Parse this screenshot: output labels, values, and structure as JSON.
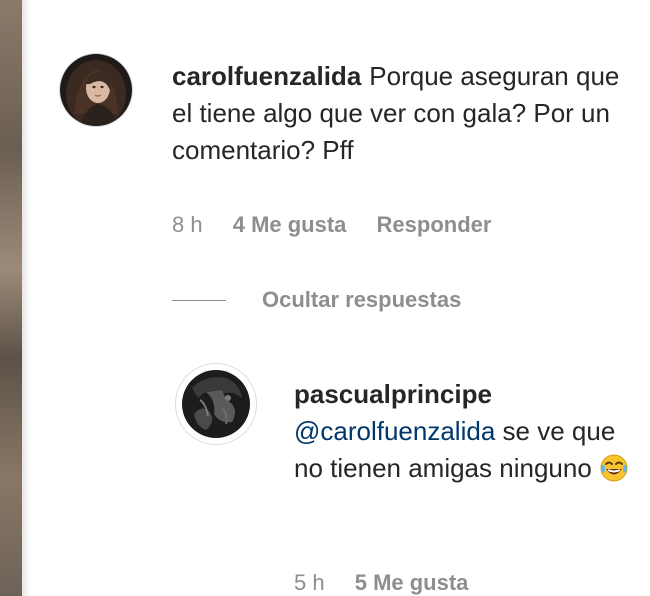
{
  "comment": {
    "username": "carolfuenzalida",
    "text": "Porque aseguran que el tiene algo que ver con gala? Por un comentario? Pff",
    "time": "8 h",
    "likes": "4 Me gusta",
    "reply_label": "Responder",
    "avatar_icon": "profile-photo"
  },
  "replies_toggle": {
    "label": "Ocultar respuestas"
  },
  "reply": {
    "username": "pascualprincipe",
    "mention": "@carolfuenzalida",
    "text": "se ve que no tienen amigas ninguno",
    "emoji_icon": "face-with-tears-of-joy-icon",
    "time": "5 h",
    "likes": "5 Me gusta",
    "avatar_icon": "profile-photo"
  },
  "colors": {
    "text": "#262626",
    "muted": "#8e8e8e",
    "mention": "#00376b"
  }
}
